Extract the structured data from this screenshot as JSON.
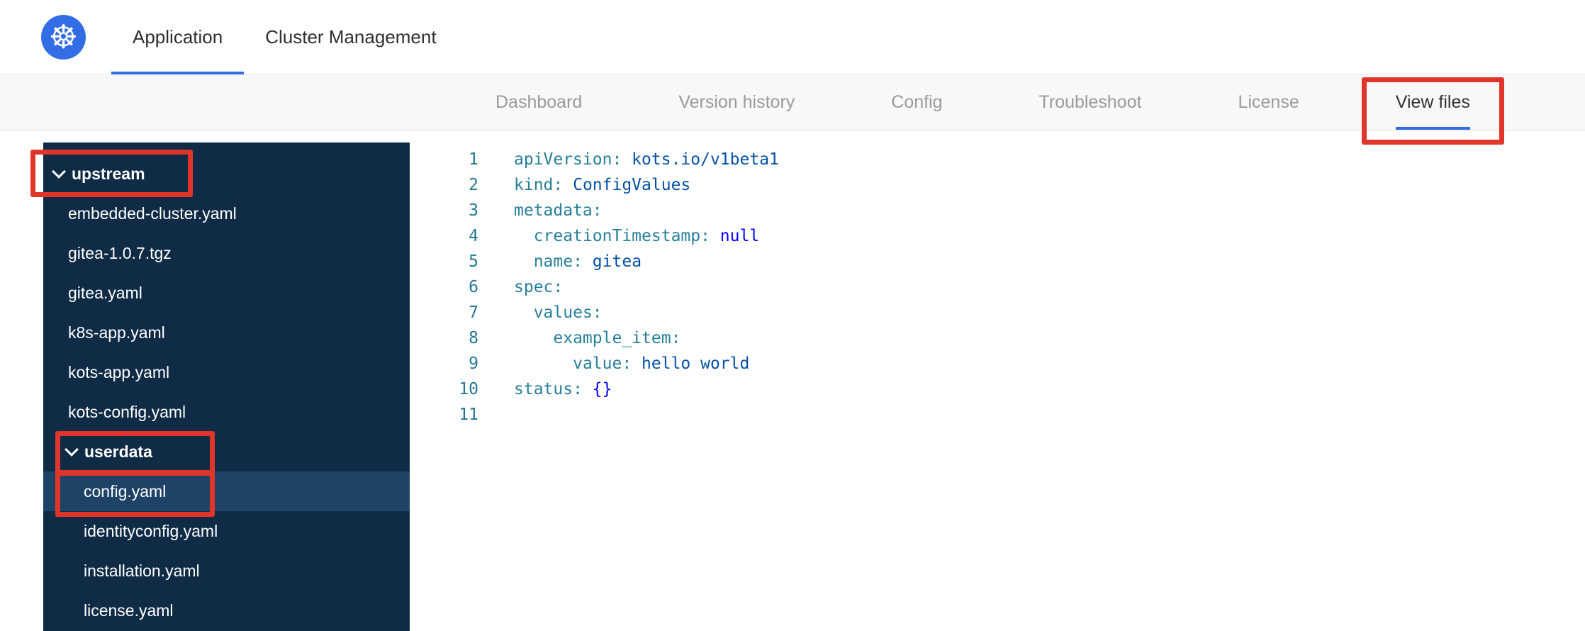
{
  "colors": {
    "accent": "#326de6",
    "annotation": "#e0352b",
    "subnav_bg": "#f8f8f8",
    "tab_inactive": "#9a9a9a",
    "sidebar_bg": "#0f2b46",
    "sidebar_selected": "#1e4366",
    "code_key": "#267f99",
    "code_val": "#0451a5",
    "code_kw": "#0000ff",
    "line_number": "#237893"
  },
  "topnav": {
    "tabs": [
      {
        "label": "Application",
        "active": true
      },
      {
        "label": "Cluster Management",
        "active": false
      }
    ]
  },
  "subnav": {
    "tabs": [
      {
        "label": "Dashboard",
        "active": false
      },
      {
        "label": "Version history",
        "active": false
      },
      {
        "label": "Config",
        "active": false
      },
      {
        "label": "Troubleshoot",
        "active": false
      },
      {
        "label": "License",
        "active": false
      },
      {
        "label": "View files",
        "active": true,
        "annotated": true
      }
    ]
  },
  "file_tree": {
    "root": {
      "label": "upstream",
      "expanded": true,
      "annotated": true,
      "files": [
        {
          "name": "embedded-cluster.yaml"
        },
        {
          "name": "gitea-1.0.7.tgz"
        },
        {
          "name": "gitea.yaml"
        },
        {
          "name": "k8s-app.yaml"
        },
        {
          "name": "kots-app.yaml"
        },
        {
          "name": "kots-config.yaml"
        }
      ],
      "subsections": [
        {
          "label": "userdata",
          "expanded": true,
          "annotated": true,
          "files": [
            {
              "name": "config.yaml",
              "selected": true,
              "annotated": true
            },
            {
              "name": "identityconfig.yaml"
            },
            {
              "name": "installation.yaml"
            },
            {
              "name": "license.yaml"
            }
          ]
        }
      ]
    }
  },
  "editor": {
    "lines": [
      {
        "n": "1",
        "tokens": [
          {
            "t": "key",
            "s": "apiVersion:"
          },
          {
            "t": "val",
            "s": " kots.io/v1beta1"
          }
        ]
      },
      {
        "n": "2",
        "tokens": [
          {
            "t": "key",
            "s": "kind:"
          },
          {
            "t": "val",
            "s": " ConfigValues"
          }
        ]
      },
      {
        "n": "3",
        "tokens": [
          {
            "t": "key",
            "s": "metadata:"
          }
        ]
      },
      {
        "n": "4",
        "tokens": [
          {
            "t": "plain",
            "s": "  "
          },
          {
            "t": "key",
            "s": "creationTimestamp:"
          },
          {
            "t": "kw",
            "s": " null"
          }
        ]
      },
      {
        "n": "5",
        "tokens": [
          {
            "t": "plain",
            "s": "  "
          },
          {
            "t": "key",
            "s": "name:"
          },
          {
            "t": "val",
            "s": " gitea"
          }
        ]
      },
      {
        "n": "6",
        "tokens": [
          {
            "t": "key",
            "s": "spec:"
          }
        ]
      },
      {
        "n": "7",
        "tokens": [
          {
            "t": "plain",
            "s": "  "
          },
          {
            "t": "key",
            "s": "values:"
          }
        ]
      },
      {
        "n": "8",
        "tokens": [
          {
            "t": "plain",
            "s": "    "
          },
          {
            "t": "key",
            "s": "example_item:"
          }
        ]
      },
      {
        "n": "9",
        "tokens": [
          {
            "t": "plain",
            "s": "      "
          },
          {
            "t": "key",
            "s": "value:"
          },
          {
            "t": "val",
            "s": " hello world"
          }
        ]
      },
      {
        "n": "10",
        "tokens": [
          {
            "t": "key",
            "s": "status:"
          },
          {
            "t": "kw",
            "s": " {}"
          }
        ]
      },
      {
        "n": "11",
        "tokens": []
      }
    ]
  }
}
